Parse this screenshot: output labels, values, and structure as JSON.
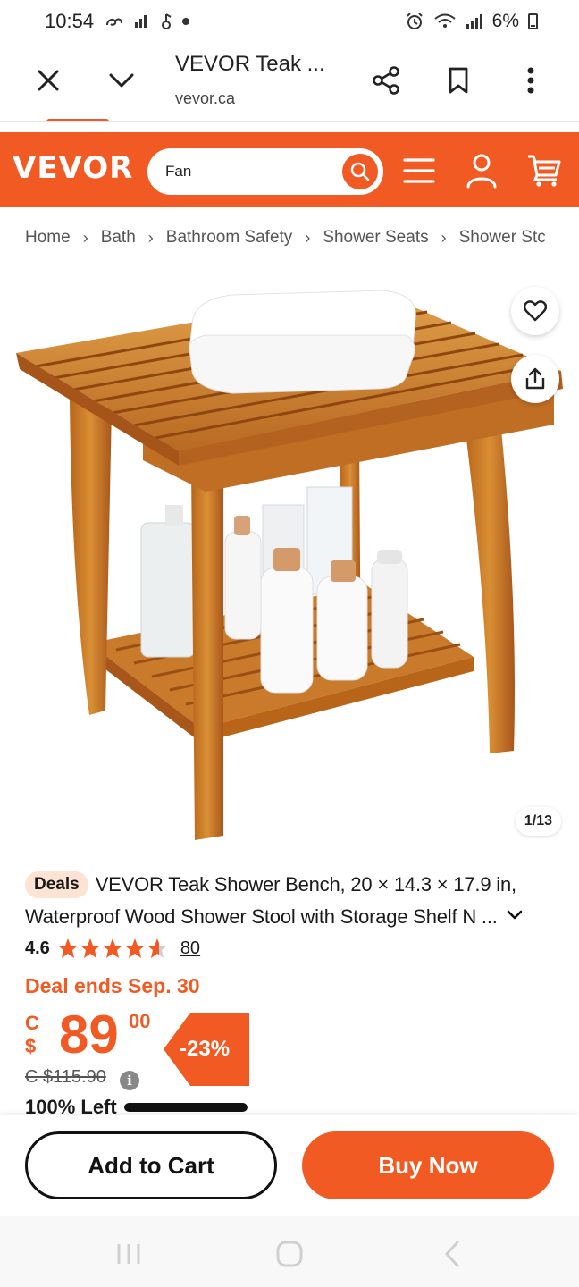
{
  "status_bar": {
    "time": "10:54",
    "battery": "6%"
  },
  "browser": {
    "title": "VEVOR Teak ...",
    "url": "vevor.ca"
  },
  "site_header": {
    "logo": "VEVOR",
    "search": {
      "value": "Fan"
    },
    "accent_color": "#f25a23"
  },
  "breadcrumb": [
    "Home",
    "Bath",
    "Bathroom Safety",
    "Shower Seats",
    "Shower Stc"
  ],
  "product": {
    "image_counter": "1/13",
    "badge": "Deals",
    "title": "VEVOR Teak Shower Bench, 20 × 14.3 × 17.9 in, Waterproof Wood Shower Stool with Storage Shelf N ...",
    "rating": "4.6",
    "stars": 4.6,
    "review_count": "80",
    "deal_ends": "Deal ends Sep. 30",
    "price": {
      "currency": "C $",
      "whole": "89",
      "cents": "00"
    },
    "discount": "-23%",
    "original_price": "C $115.90",
    "stock_label": "100% Left",
    "stock_fraction": 1.0
  },
  "actions": {
    "add_to_cart": "Add to Cart",
    "buy_now": "Buy Now"
  }
}
